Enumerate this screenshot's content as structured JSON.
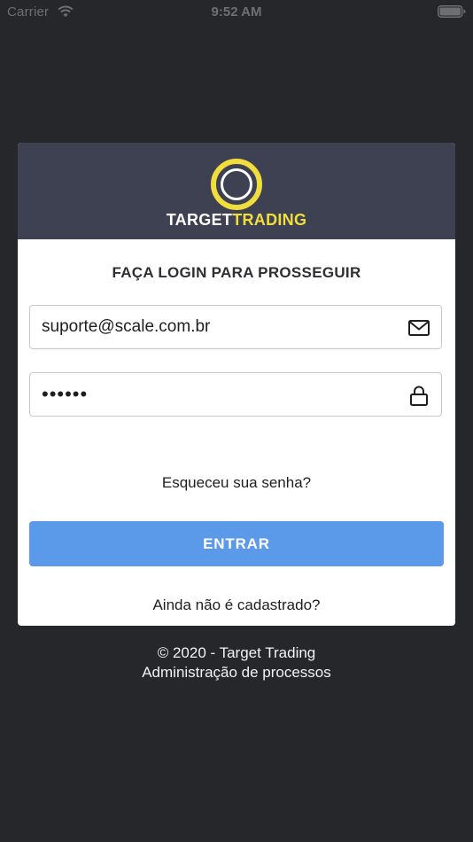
{
  "status_bar": {
    "carrier": "Carrier",
    "time": "9:52 AM",
    "wifi_icon": "wifi-icon",
    "battery_icon": "battery-icon"
  },
  "brand": {
    "logo_icon": "target-ring-logo",
    "name_part_1": "TARGET",
    "name_part_2": "TRADING",
    "header_color": "#3e4151",
    "accent_color": "#f1dd3c"
  },
  "login": {
    "heading": "FAÇA LOGIN PARA PROSSEGUIR",
    "email": {
      "value": "suporte@scale.com.br",
      "icon": "envelope-icon"
    },
    "password": {
      "value": "••••••",
      "icon": "lock-icon"
    },
    "forgot_password": "Esqueceu sua senha?",
    "submit_label": "ENTRAR",
    "submit_color": "#5b9ae8",
    "signup": "Ainda não é cadastrado?"
  },
  "footer": {
    "copyright": "© 2020 - Target Trading",
    "tagline": "Administração de processos"
  },
  "colors": {
    "background": "#26272b",
    "card": "#ffffff"
  }
}
